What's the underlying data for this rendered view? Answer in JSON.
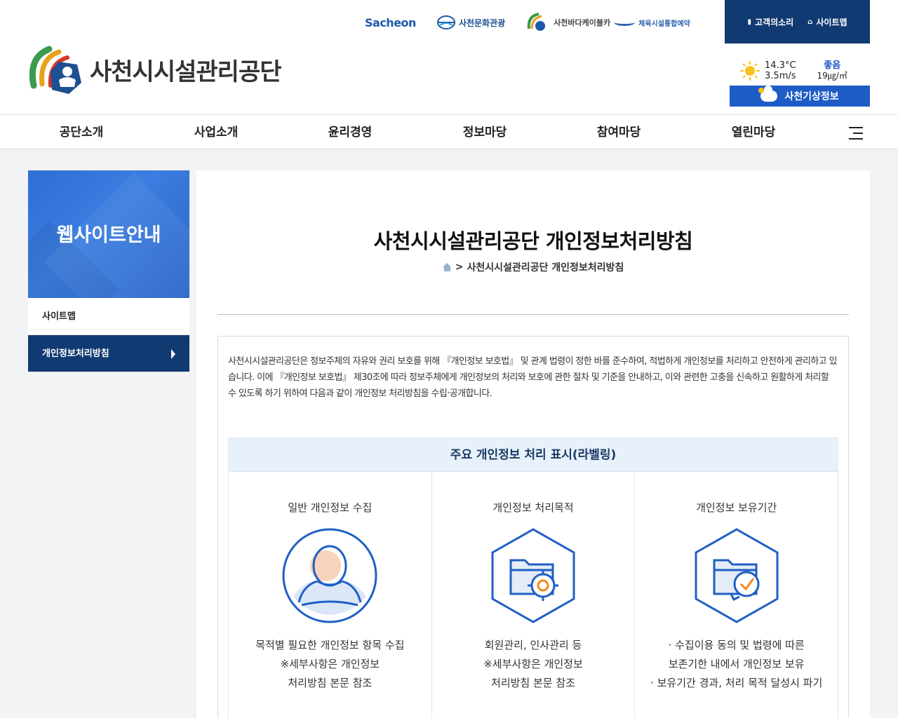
{
  "header": {
    "family_sites": [
      {
        "name": "sacheon-city",
        "label": "Sacheon"
      },
      {
        "name": "sacheon-culture-tourism",
        "label": "사천문화관광"
      },
      {
        "name": "sacheon-sea-cable-car",
        "label": "사천바다케이블카"
      },
      {
        "name": "sports-facility-reservation",
        "label": "체육시설통합예약"
      }
    ],
    "utility": {
      "voice_label": "고객의소리",
      "sitemap_label": "사이트맵"
    },
    "logo_text": "사천시시설관리공단",
    "weather": {
      "temperature": "14.3°C",
      "wind": "3.5m/s",
      "air_quality": "좋음",
      "pm": "19㎍/㎥",
      "button_label": "사천기상정보"
    }
  },
  "gnb": {
    "items": [
      "공단소개",
      "사업소개",
      "윤리경영",
      "정보마당",
      "참여마당",
      "열린마당"
    ]
  },
  "sidebar": {
    "title": "웹사이트안내",
    "items": [
      {
        "label": "사이트맵",
        "active": false
      },
      {
        "label": "개인정보처리방침",
        "active": true
      }
    ]
  },
  "main": {
    "title": "사천시시설관리공단 개인정보처리방침",
    "breadcrumb_separator": ">",
    "breadcrumb_current": "사천시시설관리공단 개인정보처리방침",
    "intro": "사천시시설관리공단은 정보주체의 자유와 권리 보호를 위해 『개인정보 보호법』 및 관계 법령이 정한 바를 준수하여, 적법하게 개인정보를 처리하고 안전하게 관리하고 있습니다. 이에 『개인정보 보호법』 제30조에 따라 정보주체에게 개인정보의 처리와 보호에 관한 절차 및 기준을 안내하고, 이와 관련한 고충을 신속하고 원활하게 처리할 수 있도록 하기 위하여 다음과 같이 개인정보 처리방침을 수립·공개합니다.",
    "labeling": {
      "heading": "주요 개인정보 처리 표시(라벨링)",
      "columns": [
        {
          "title": "일반 개인정보 수집",
          "icon": "user-icon",
          "lines": [
            "목적별 필요한 개인정보 항목 수집",
            "※세부사항은 개인정보",
            "처리방침 본문 참조"
          ]
        },
        {
          "title": "개인정보 처리목적",
          "icon": "folder-gear-icon",
          "lines": [
            "회원관리, 인사관리 등",
            "※세부사항은 개인정보",
            "처리방침 본문 참조"
          ]
        },
        {
          "title": "개인정보 보유기간",
          "icon": "folder-clock-icon",
          "lines": [
            "· 수집이용 동의 및 법령에 따른",
            "보존기한 내에서 개인정보 보유",
            "· 보유기간 경과, 처리 목적 달성시 파기"
          ]
        }
      ]
    }
  },
  "colors": {
    "navy": "#123a72",
    "blue": "#1e5cc6",
    "label_bg": "#e8f1f9"
  }
}
